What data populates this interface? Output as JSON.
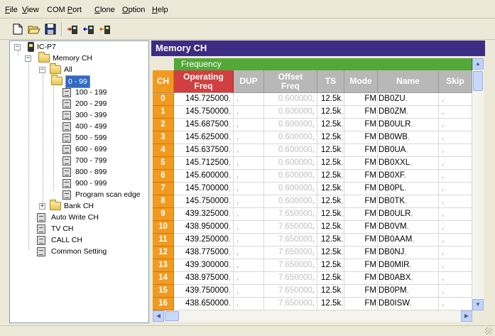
{
  "menu": [
    {
      "label": "File",
      "underline": "F",
      "rest": "ile"
    },
    {
      "label": "View",
      "underline": "V",
      "rest": "iew"
    },
    {
      "label": "COM Port",
      "pre": "COM ",
      "underline": "P",
      "rest": "ort"
    },
    {
      "label": "Clone",
      "underline": "C",
      "rest": "lone"
    },
    {
      "label": "Option",
      "underline": "O",
      "rest": "ption"
    },
    {
      "label": "Help",
      "underline": "H",
      "rest": "elp"
    }
  ],
  "toolbar": {
    "icons": [
      "new-file-icon",
      "open-folder-icon",
      "save-disk-icon",
      "read-from-radio-icon",
      "write-to-radio-icon",
      "write-selected-to-radio-icon"
    ]
  },
  "tree": {
    "root": "IC-P7",
    "memory_ch": "Memory CH",
    "all": "All",
    "ranges": [
      "0 - 99",
      "100 - 199",
      "200 - 299",
      "300 - 399",
      "400 - 499",
      "500 - 599",
      "600 - 699",
      "700 - 799",
      "800 - 899",
      "900 - 999",
      "Program scan edge"
    ],
    "bank_ch": "Bank CH",
    "auto_write": "Auto Write CH",
    "tv_ch": "TV CH",
    "call_ch": "CALL CH",
    "common": "Common Setting"
  },
  "panel": {
    "title": "Memory CH",
    "group_header": "Frequency",
    "columns": {
      "ch": "CH",
      "freq_l1": "Operating",
      "freq_l2": "Freq",
      "dup": "DUP",
      "offset_l1": "Offset",
      "offset_l2": "Freq",
      "ts": "TS",
      "mode": "Mode",
      "name": "Name",
      "skip": "Skip"
    }
  },
  "rows": [
    {
      "ch": "0",
      "freq": "145.725000",
      "offset": "0.600000",
      "ts": "12.5k",
      "mode": "FM",
      "name": "DB0ZU"
    },
    {
      "ch": "1",
      "freq": "145.750000",
      "offset": "0.600000",
      "ts": "12.5k",
      "mode": "FM",
      "name": "DB0ZM"
    },
    {
      "ch": "2",
      "freq": "145.687500",
      "offset": "0.600000",
      "ts": "12.5k",
      "mode": "FM",
      "name": "DB0ULR"
    },
    {
      "ch": "3",
      "freq": "145.625000",
      "offset": "0.600000",
      "ts": "12.5k",
      "mode": "FM",
      "name": "DB0WB"
    },
    {
      "ch": "4",
      "freq": "145.637500",
      "offset": "0.600000",
      "ts": "12.5k",
      "mode": "FM",
      "name": "DB0UA"
    },
    {
      "ch": "5",
      "freq": "145.712500",
      "offset": "0.600000",
      "ts": "12.5k",
      "mode": "FM",
      "name": "DB0XXL"
    },
    {
      "ch": "6",
      "freq": "145.600000",
      "offset": "0.600000",
      "ts": "12.5k",
      "mode": "FM",
      "name": "DB0XF"
    },
    {
      "ch": "7",
      "freq": "145.700000",
      "offset": "0.600000",
      "ts": "12.5k",
      "mode": "FM",
      "name": "DB0PL"
    },
    {
      "ch": "8",
      "freq": "145.750000",
      "offset": "0.600000",
      "ts": "12.5k",
      "mode": "FM",
      "name": "DB0TK"
    },
    {
      "ch": "9",
      "freq": "439.325000",
      "offset": "7.650000",
      "ts": "12.5k",
      "mode": "FM",
      "name": "DB0ULR"
    },
    {
      "ch": "10",
      "freq": "438.950000",
      "offset": "7.650000",
      "ts": "12.5k",
      "mode": "FM",
      "name": "DB0VM"
    },
    {
      "ch": "11",
      "freq": "439.250000",
      "offset": "7.650000",
      "ts": "12.5k",
      "mode": "FM",
      "name": "DB0AAM"
    },
    {
      "ch": "12",
      "freq": "438.775000",
      "offset": "7.650000",
      "ts": "12.5k",
      "mode": "FM",
      "name": "DB0NJ"
    },
    {
      "ch": "13",
      "freq": "439.300000",
      "offset": "7.650000",
      "ts": "12.5k",
      "mode": "FM",
      "name": "DB0MIR"
    },
    {
      "ch": "14",
      "freq": "438.975000",
      "offset": "7.650000",
      "ts": "12.5k",
      "mode": "FM",
      "name": "DB0ABX"
    },
    {
      "ch": "15",
      "freq": "439.750000",
      "offset": "7.650000",
      "ts": "12.5k",
      "mode": "FM",
      "name": "DB0PM"
    },
    {
      "ch": "16",
      "freq": "438.650000",
      "offset": "7.650000",
      "ts": "12.5k",
      "mode": "FM",
      "name": "DB0ISW"
    }
  ],
  "colors": {
    "title_bar": "#3c2c82",
    "group_header": "#54a838",
    "ch_column": "#f29a1f",
    "freq_header": "#d04040",
    "header_gray": "#b8b8b8"
  }
}
